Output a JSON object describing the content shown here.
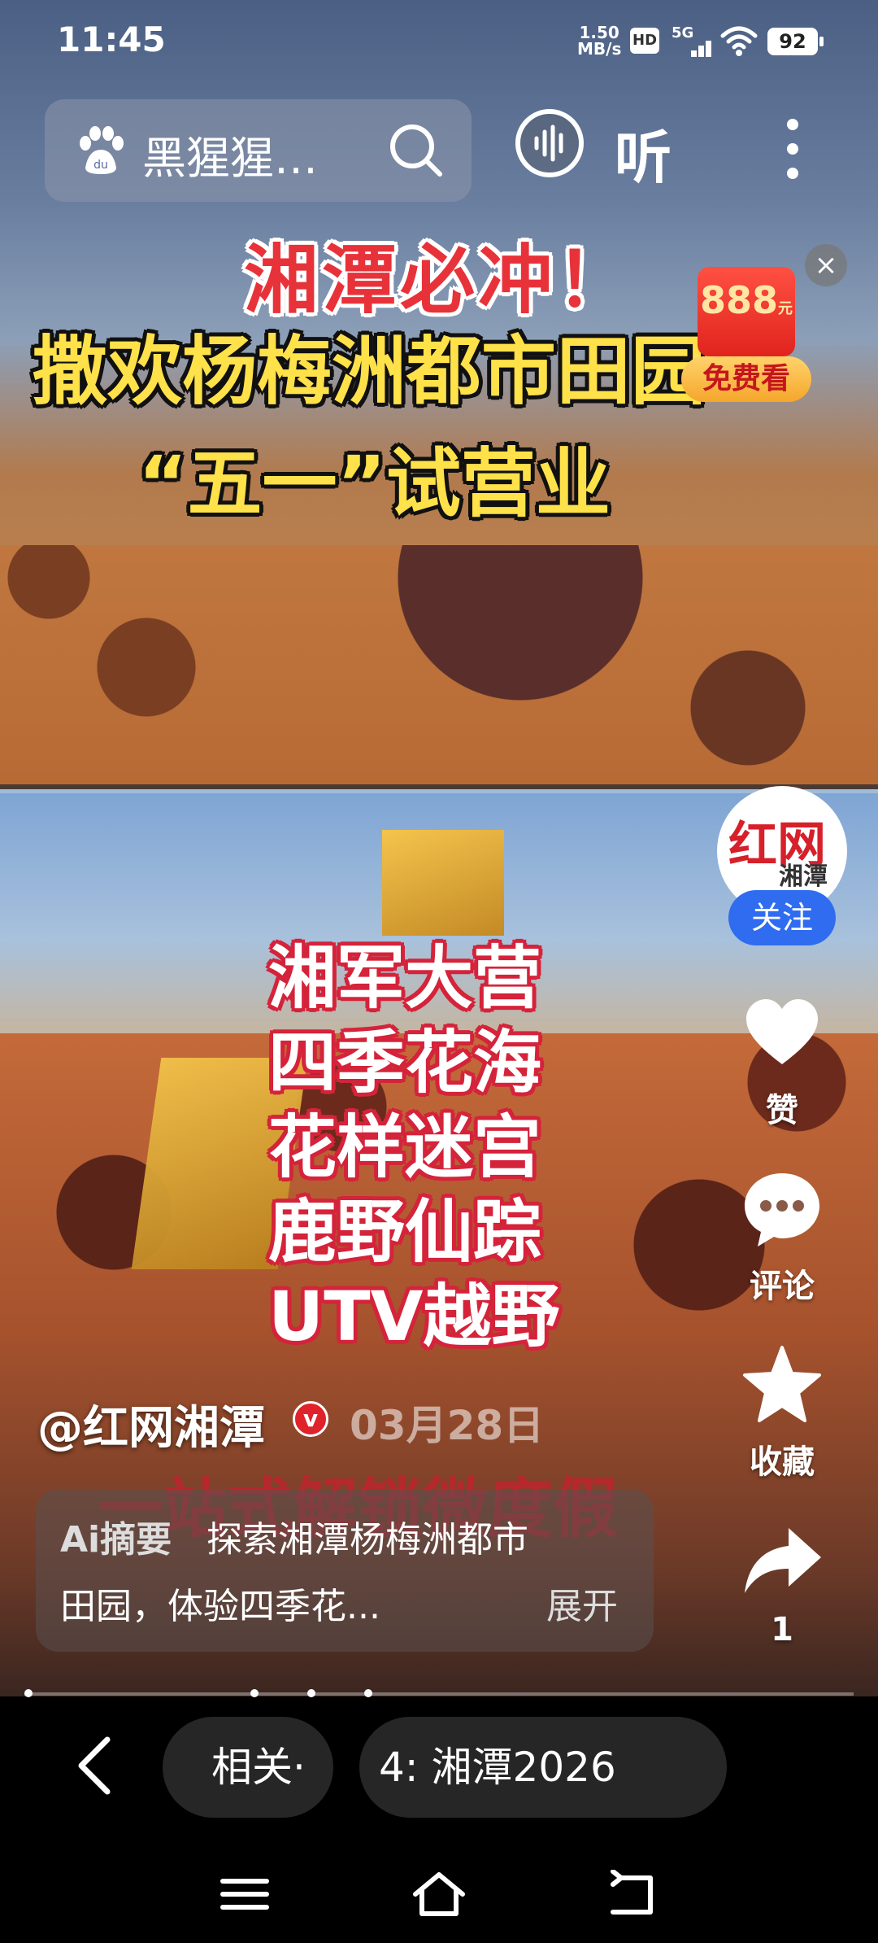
{
  "status_bar": {
    "time": "11:45",
    "net_speed_value": "1.50",
    "net_speed_unit": "MB/s",
    "hd": "HD",
    "network": "5G",
    "battery": "92"
  },
  "top_bar": {
    "search_text": "黑猩猩…",
    "listen_label": "听"
  },
  "ad": {
    "amount": "888",
    "unit": "元",
    "button_label": "免费看",
    "close_label": "×"
  },
  "video_overlay": {
    "headline_line1": "湘潭必冲！",
    "headline_line2": "撒欢杨梅洲都市田园",
    "headline_line3": "“五一”试营业",
    "features": [
      "湘军大营",
      "四季花海",
      "花样迷宫",
      "鹿野仙踪",
      "UTV越野"
    ],
    "slogan": "一站式解锁微度假"
  },
  "author": {
    "avatar_logo": "红网",
    "avatar_station": "湘潭站",
    "follow_label": "关注",
    "name": "@红网湘潭",
    "verified_mark": "v",
    "date": "03月28日"
  },
  "actions": {
    "like_label": "赞",
    "comment_label": "评论",
    "favorite_label": "收藏",
    "share_count": "1"
  },
  "summary": {
    "ai_label": "Ai摘要",
    "line1": "探索湘潭杨梅洲都市",
    "line2": "田园，体验四季花...",
    "expand_label": "展开"
  },
  "bottom_chips": {
    "chip1": "相关·",
    "chip2": "4: 湘潭2026"
  },
  "colors": {
    "follow_button": "#2f6cf0",
    "verified_badge": "#e0222a",
    "headline_red": "#e8323a",
    "headline_yellow": "#ffe14a"
  }
}
